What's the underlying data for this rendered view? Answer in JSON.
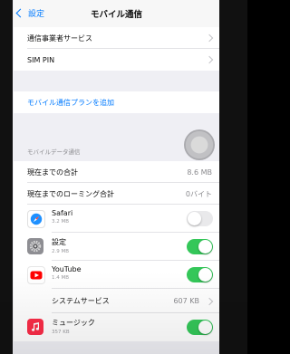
{
  "nav": {
    "back_label": "設定",
    "title": "モバイル通信"
  },
  "rows": {
    "carrier_services": "通信事業者サービス",
    "sim_pin": "SIM PIN",
    "add_plan": "モバイル通信プランを追加"
  },
  "section": {
    "header": "モバイルデータ通信"
  },
  "stats": {
    "current_period_label": "現在までの合計",
    "current_period_value": "8.6 MB",
    "roaming_label": "現在までのローミング合計",
    "roaming_value": "0バイト"
  },
  "apps": [
    {
      "name": "Safari",
      "size": "3.2 MB",
      "enabled": false,
      "icon": "safari-icon",
      "color": "#1e90ff"
    },
    {
      "name": "設定",
      "size": "2.9 MB",
      "enabled": true,
      "icon": "settings-gear-icon",
      "color": "#8e8e93"
    },
    {
      "name": "YouTube",
      "size": "1.4 MB",
      "enabled": true,
      "icon": "youtube-icon",
      "color": "#ff0000"
    }
  ],
  "system_services": {
    "label": "システムサービス",
    "value": "607 KB"
  },
  "music": {
    "name": "ミュージック",
    "size": "357 KB",
    "enabled": true,
    "icon": "music-note-icon",
    "color": "#fa2d48"
  },
  "colors": {
    "accent": "#007aff",
    "toggle_on": "#34c759"
  }
}
